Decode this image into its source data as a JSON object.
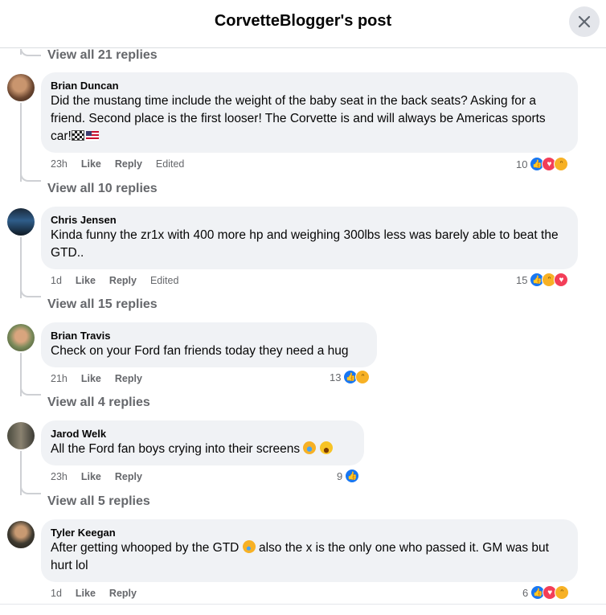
{
  "header": {
    "title": "CorvetteBlogger's post"
  },
  "comments": [
    {
      "view_replies_above": "View all 21 replies",
      "author": "Brian Duncan",
      "text": "Did the mustang time include the weight of the baby seat in the back seats? Asking for a friend. Second place is the first looser! The Corvette is and will always be Americas sports car!",
      "time": "23h",
      "like": "Like",
      "reply": "Reply",
      "edited": "Edited",
      "reaction_count": "10",
      "reactions": [
        "like",
        "love",
        "haha"
      ],
      "view_replies": "View all 10 replies"
    },
    {
      "author": "Chris Jensen",
      "text": "Kinda funny the zr1x with 400 more hp and weighing 300lbs less was barely able to beat the GTD..",
      "time": "1d",
      "like": "Like",
      "reply": "Reply",
      "edited": "Edited",
      "reaction_count": "15",
      "reactions": [
        "like",
        "haha",
        "love"
      ],
      "view_replies": "View all 15 replies"
    },
    {
      "author": "Brian Travis",
      "text": "Check on your Ford fan friends today they need a hug",
      "time": "21h",
      "like": "Like",
      "reply": "Reply",
      "reaction_count": "13",
      "reactions": [
        "like",
        "haha"
      ],
      "view_replies": "View all 4 replies"
    },
    {
      "author": "Jarod Welk",
      "text": "All the Ford fan boys crying into their screens",
      "time": "23h",
      "like": "Like",
      "reply": "Reply",
      "reaction_count": "9",
      "reactions": [
        "like"
      ],
      "view_replies": "View all 5 replies"
    },
    {
      "author": "Tyler Keegan",
      "text_before": "After getting whooped by the GTD",
      "text_after": "also the x is the only one who passed it. GM was but hurt lol",
      "time": "1d",
      "like": "Like",
      "reply": "Reply",
      "reaction_count": "6",
      "reactions": [
        "like",
        "love",
        "haha"
      ]
    }
  ],
  "colors": {
    "like": "#1877f2",
    "love": "#f33e58",
    "haha": "#f7b125",
    "bubble": "#f0f2f5",
    "meta": "#65676b"
  }
}
